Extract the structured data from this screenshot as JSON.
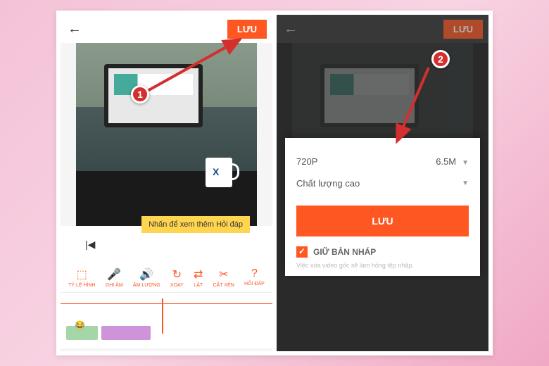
{
  "left": {
    "save": "LƯU",
    "tooltip": "Nhấn để xem thêm Hỏi đáp",
    "tools": [
      {
        "icon": "⬚",
        "label": "TỶ LỆ HÌNH"
      },
      {
        "icon": "🎤",
        "label": "GHI ÂM"
      },
      {
        "icon": "🔊",
        "label": "ÂM LƯỢNG"
      },
      {
        "icon": "↻",
        "label": "XOAY"
      },
      {
        "icon": "⇄",
        "label": "LẬT"
      },
      {
        "icon": "✂",
        "label": "CẮT XÉN"
      },
      {
        "icon": "?",
        "label": "HỎI ĐÁP"
      }
    ],
    "mug_logo": "X",
    "emoji": "😂"
  },
  "right": {
    "save": "LƯU",
    "resolution": "720P",
    "size": "6.5M",
    "quality": "Chất lượng cao",
    "big_save": "LƯU",
    "draft": "GIỮ BẢN NHÁP",
    "hint": "Việc xóa video gốc sẽ làm hỏng tệp nhập."
  },
  "badges": {
    "one": "1",
    "two": "2"
  }
}
